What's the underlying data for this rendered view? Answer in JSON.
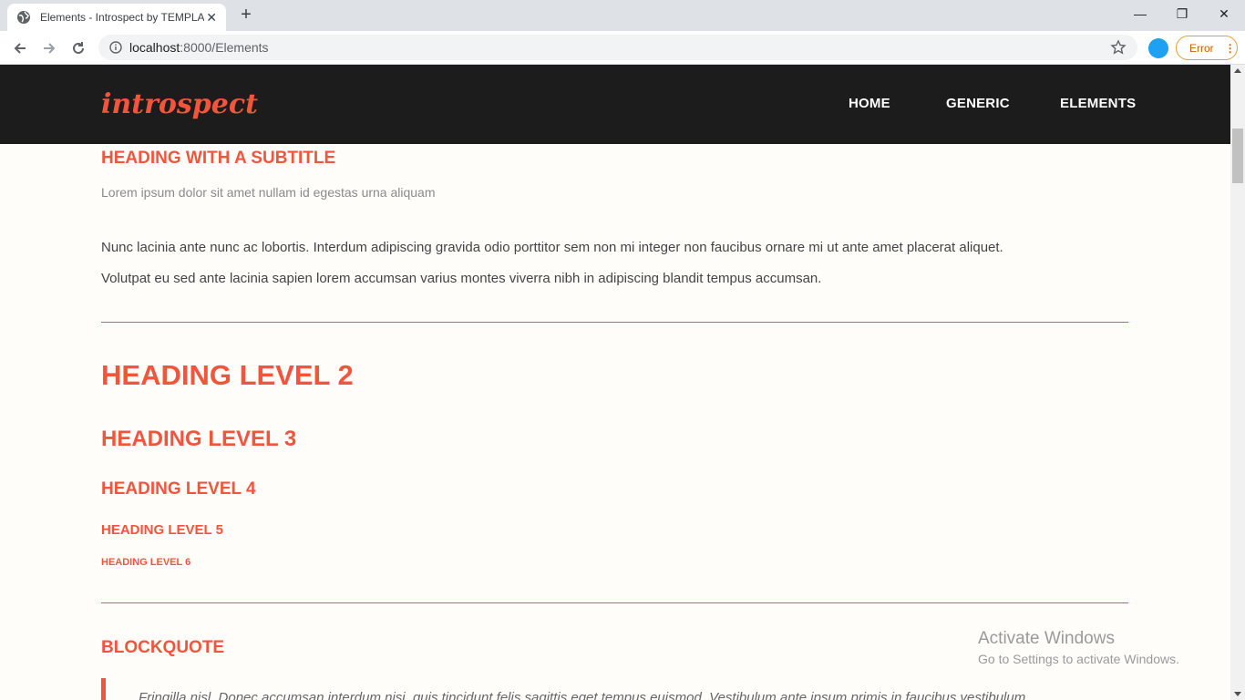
{
  "browser": {
    "tab_title": "Elements - Introspect by TEMPLA",
    "tab_close": "✕",
    "new_tab": "+",
    "url_host": "localhost",
    "url_path": ":8000/Elements",
    "error_label": "Error",
    "window_controls": {
      "minimize": "—",
      "restore": "❐",
      "close": "✕"
    }
  },
  "site": {
    "logo": "introspect",
    "nav": [
      "HOME",
      "GENERIC",
      "ELEMENTS"
    ],
    "heading_with_subtitle": "HEADING WITH A SUBTITLE",
    "subtitle": "Lorem ipsum dolor sit amet nullam id egestas urna aliquam",
    "paragraph_line1": "Nunc lacinia ante nunc ac lobortis. Interdum adipiscing gravida odio porttitor sem non mi integer non faucibus ornare mi ut ante amet placerat aliquet.",
    "paragraph_line2": "Volutpat eu sed ante lacinia sapien lorem accumsan varius montes viverra nibh in adipiscing blandit tempus accumsan.",
    "headings": {
      "h2": "HEADING LEVEL 2",
      "h3": "HEADING LEVEL 3",
      "h4": "HEADING LEVEL 4",
      "h5": "HEADING LEVEL 5",
      "h6": "HEADING LEVEL 6"
    },
    "blockquote_heading": "BLOCKQUOTE",
    "blockquote_text": "Fringilla nisl. Donec accumsan interdum nisi, quis tincidunt felis sagittis eget tempus euismod. Vestibulum ante ipsum primis in faucibus vestibulum."
  },
  "os_overlay": {
    "line1": "Activate Windows",
    "line2": "Go to Settings to activate Windows."
  },
  "colors": {
    "accent": "#f2553c",
    "header_bg": "#1c1c1c",
    "page_bg": "#fffdfa"
  }
}
